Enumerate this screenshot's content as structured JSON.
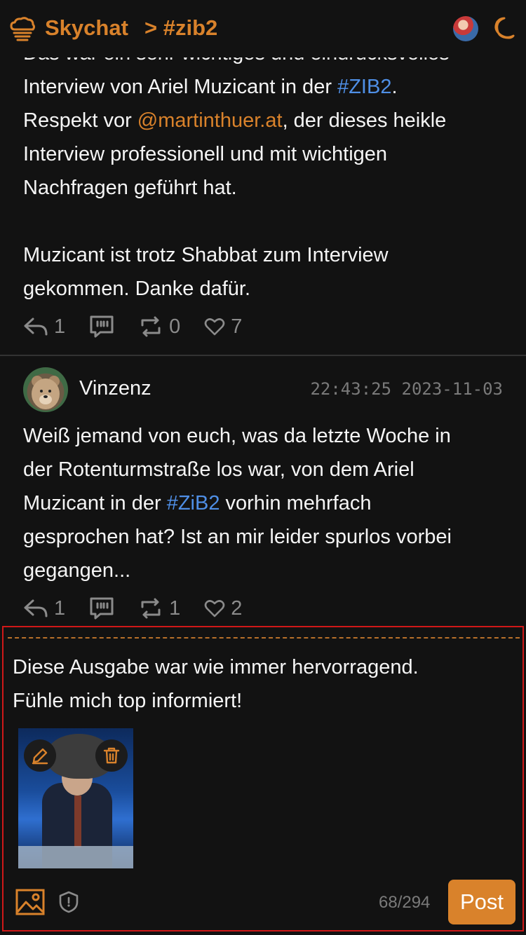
{
  "header": {
    "brand": "Skychat",
    "channel": "> #zib2"
  },
  "post1": {
    "line0": "Das war ein sehr wichtiges und eindrucksvolles",
    "line1a": "Interview von Ariel Muzicant in der ",
    "line1_hashtag": "#ZIB2",
    "line1b": ".",
    "line2a": "Respekt vor ",
    "line2_mention": "@martinthuer.at",
    "line2b": ", der dieses heikle",
    "line3": "Interview professionell und mit wichtigen",
    "line4": "Nachfragen geführt hat.",
    "line5": "Muzicant ist trotz Shabbat zum Interview",
    "line6": "gekommen. Danke dafür.",
    "replies": "1",
    "reposts": "0",
    "likes": "7"
  },
  "post2": {
    "author": "Vinzenz",
    "timestamp": "22:43:25 2023-11-03",
    "line1": "Weiß jemand von euch, was da letzte Woche in",
    "line2": "der Rotenturmstraße los war, von dem Ariel",
    "line3a": "Muzicant in der ",
    "line3_hashtag": "#ZiB2",
    "line3b": " vorhin mehrfach",
    "line4": "gesprochen hat? Ist an mir leider spurlos vorbei",
    "line5": "gegangen...",
    "replies": "1",
    "reposts": "1",
    "likes": "2"
  },
  "compose": {
    "line1": "Diese Ausgabe war wie immer hervorragend.",
    "line2": "Fühle mich top informiert!",
    "counter": "68/294",
    "post_label": "Post"
  },
  "colors": {
    "accent": "#d9822b",
    "hashtag": "#4f8fe6",
    "background": "#121212",
    "highlight_border": "#d01818"
  },
  "icons": {
    "logo": "cloud-chat-icon",
    "theme": "moon-icon",
    "reply": "reply-icon",
    "quote": "quote-icon",
    "repost": "repost-icon",
    "like": "heart-icon",
    "edit": "pencil-icon",
    "delete": "trash-icon",
    "add_image": "image-icon",
    "content_warning": "shield-icon"
  }
}
